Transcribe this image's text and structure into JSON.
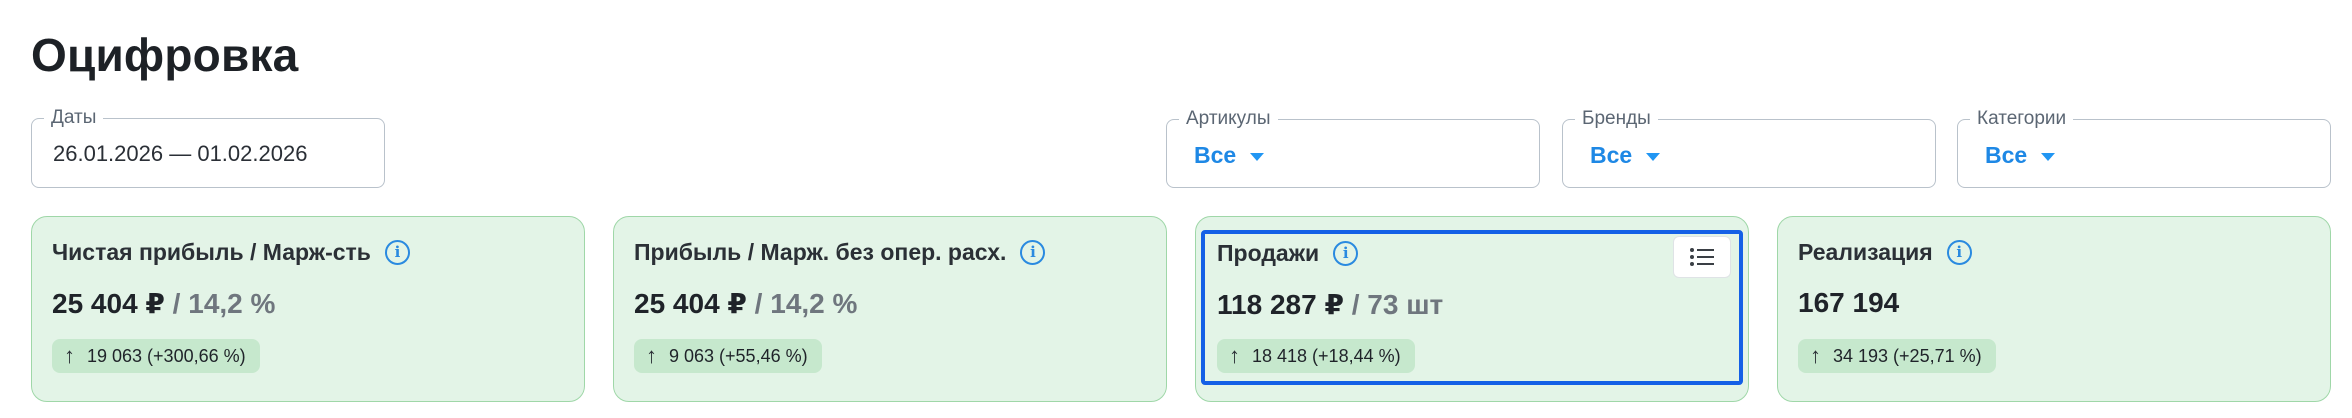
{
  "page": {
    "title": "Оцифровка"
  },
  "filters": {
    "dates": {
      "label": "Даты",
      "value": "26.01.2026 — 01.02.2026"
    },
    "articles": {
      "label": "Артикулы",
      "value": "Все"
    },
    "brands": {
      "label": "Бренды",
      "value": "Все"
    },
    "categories": {
      "label": "Категории",
      "value": "Все"
    }
  },
  "cards": [
    {
      "title": "Чистая прибыль / Марж-сть",
      "value_main": "25 404 ₽",
      "value_secondary": " / 14,2 %",
      "delta": "19 063 (+300,66 %)",
      "info_icon": "info-icon"
    },
    {
      "title": "Прибыль / Марж. без опер. расх.",
      "value_main": "25 404 ₽",
      "value_secondary": " / 14,2 %",
      "delta": "9 063 (+55,46 %)",
      "info_icon": "info-icon"
    },
    {
      "title": "Продажи",
      "value_main": "118 287 ₽",
      "value_secondary": " / 73 шт",
      "delta": "18 418 (+18,44 %)",
      "info_icon": "info-icon",
      "selected": true,
      "action_icon": "list-icon"
    },
    {
      "title": "Реализация",
      "value_main": "167 194",
      "value_secondary": "",
      "delta": "34 193 (+25,71 %)",
      "info_icon": "info-icon"
    }
  ],
  "colors": {
    "accent": "#1e88e5",
    "card_bg": "#e3f4e7",
    "card_border": "#9fd7a8",
    "badge_bg": "#c6e8cd",
    "selection": "#1460e6"
  }
}
